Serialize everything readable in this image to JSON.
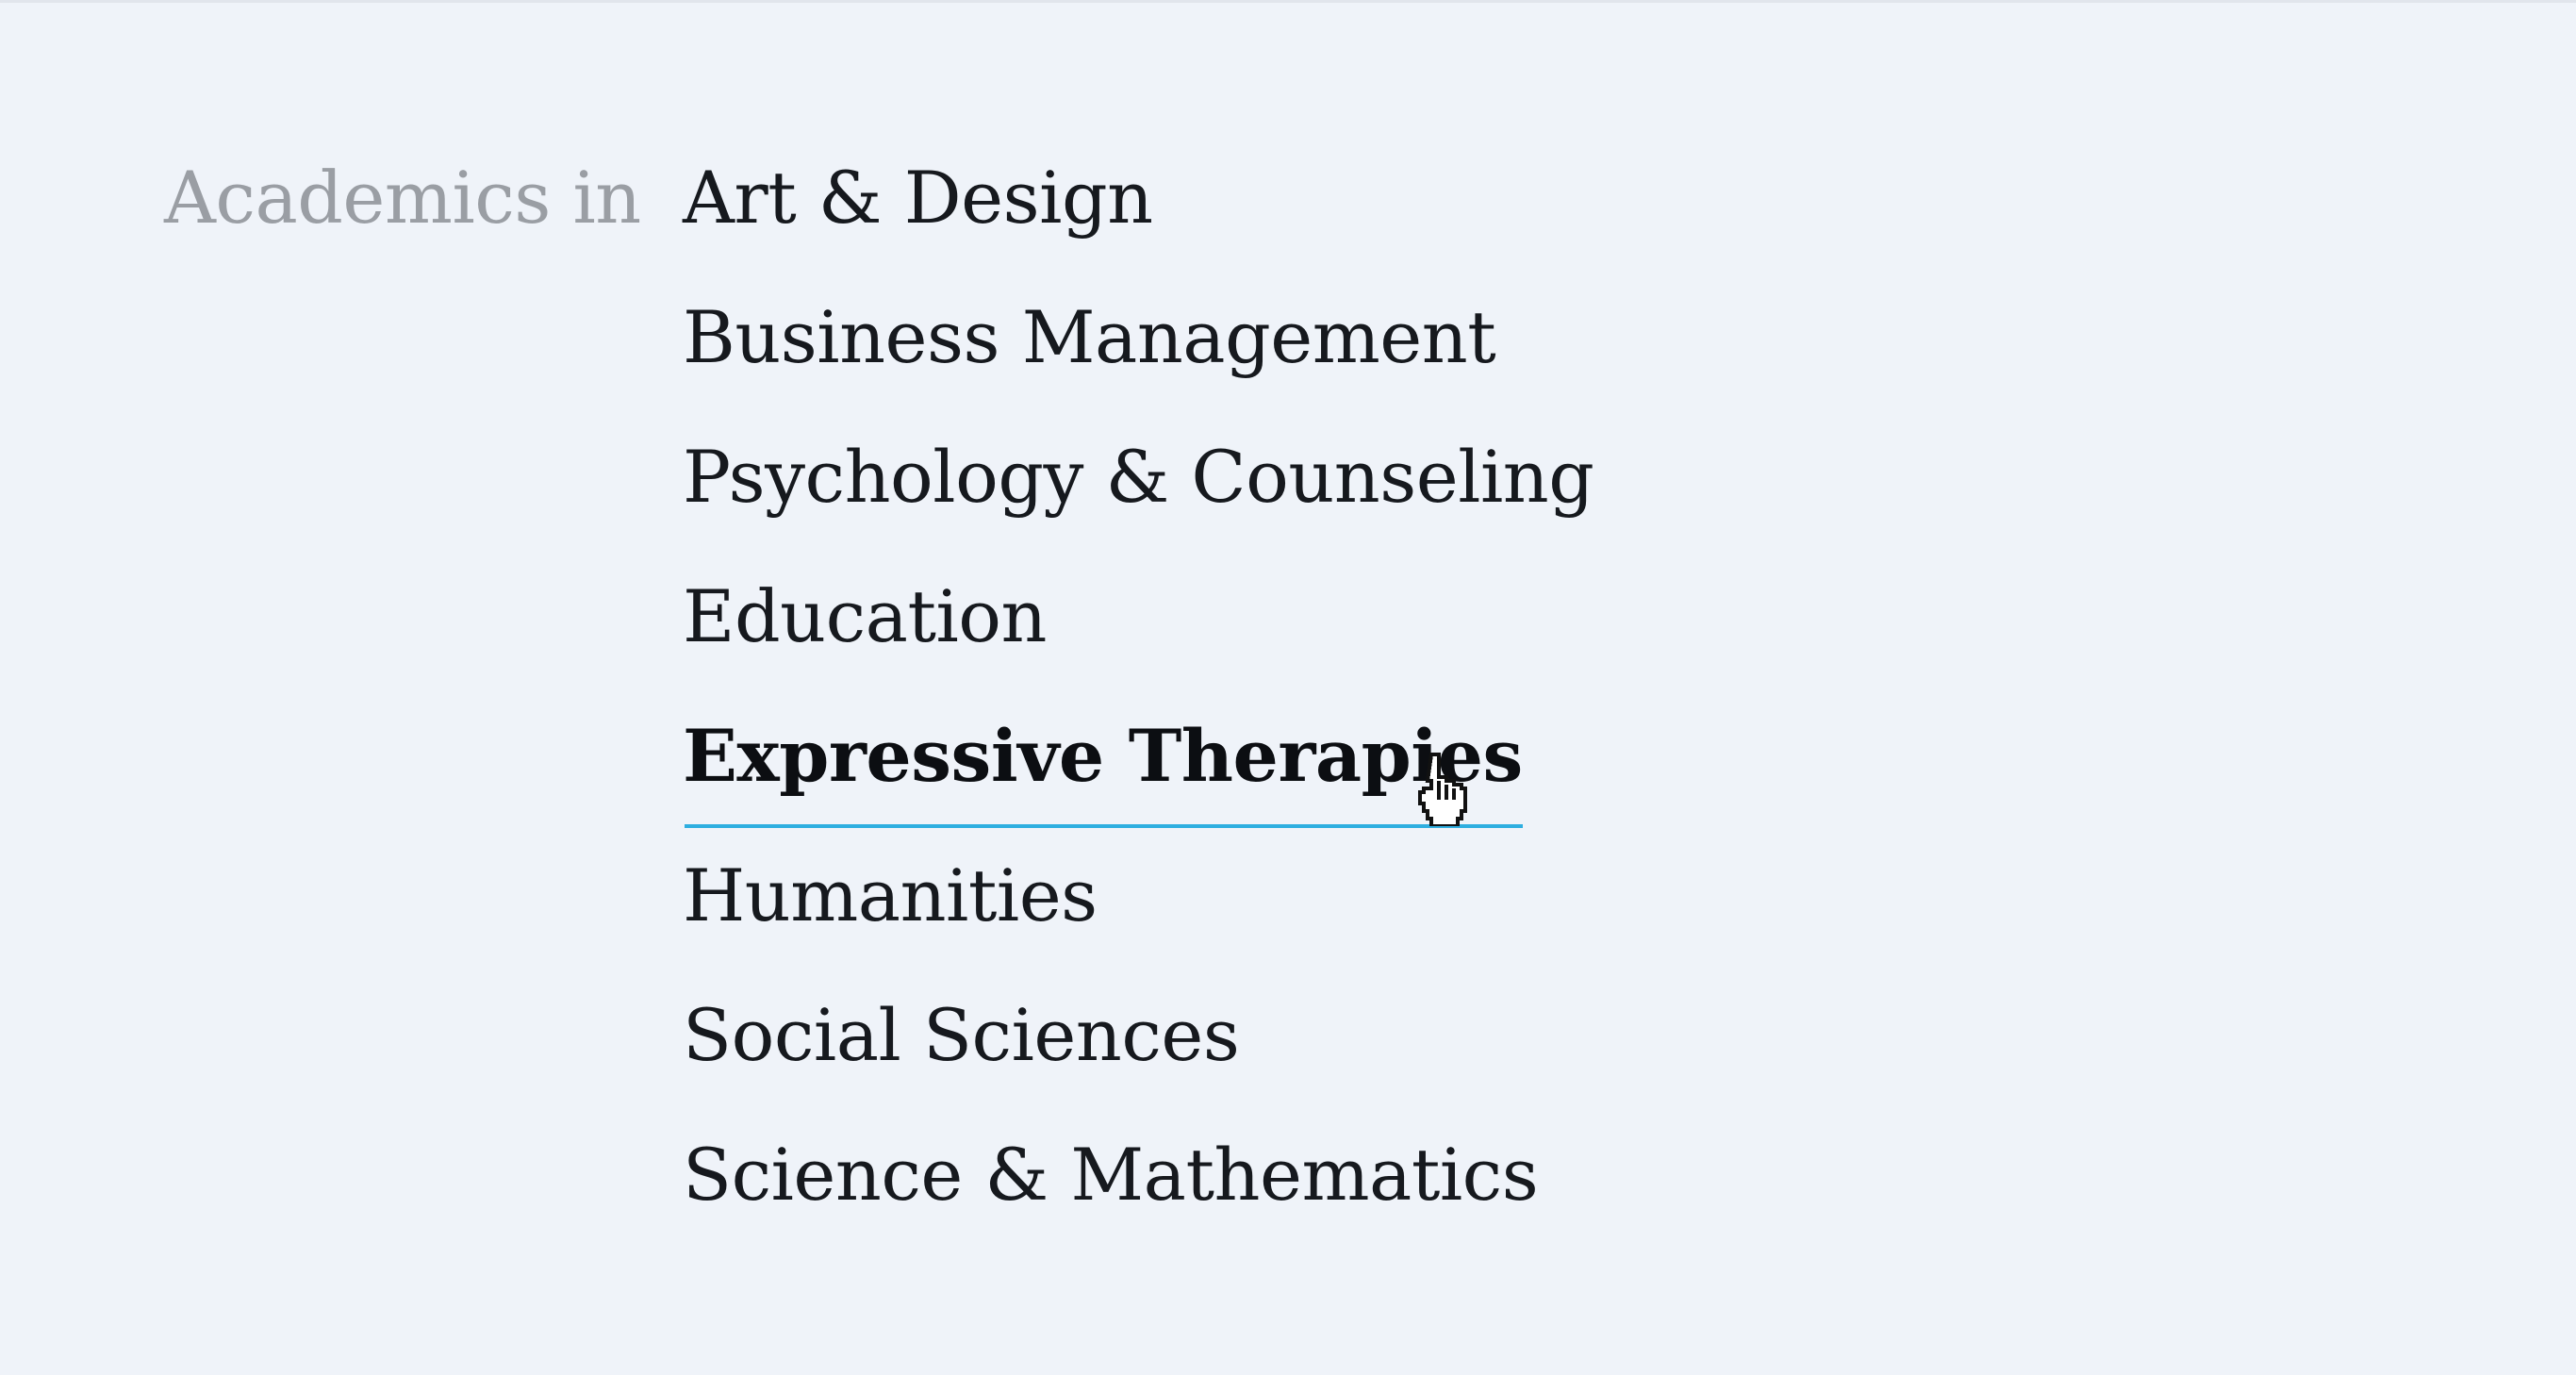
{
  "academics": {
    "intro_label": "Academics in",
    "subjects": [
      {
        "label": "Art & Design",
        "active": false
      },
      {
        "label": "Business Management",
        "active": false
      },
      {
        "label": "Psychology & Counseling",
        "active": false
      },
      {
        "label": "Education",
        "active": false
      },
      {
        "label": "Expressive Therapies",
        "active": true
      },
      {
        "label": "Humanities",
        "active": false
      },
      {
        "label": "Social Sciences",
        "active": false
      },
      {
        "label": "Science & Mathematics",
        "active": false
      }
    ]
  },
  "colors": {
    "background": "#eff3f9",
    "muted_text": "#9a9ea4",
    "text": "#16191e",
    "active_underline": "#2eaee0"
  },
  "cursor": "hand-pointer-icon"
}
